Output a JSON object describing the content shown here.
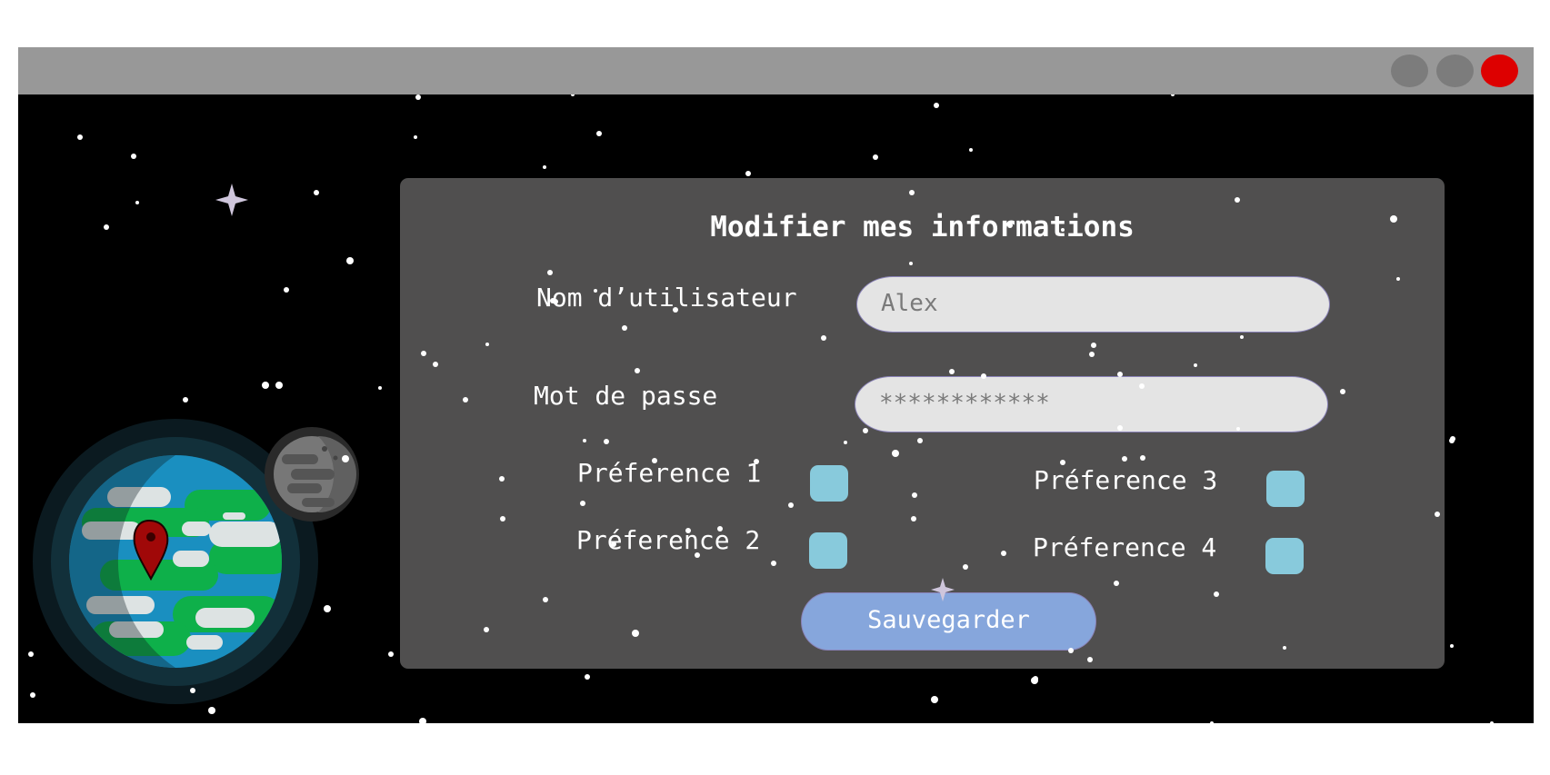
{
  "window": {
    "controls": [
      "minimize-button",
      "maximize-button",
      "close-button"
    ],
    "close_color": "#dd0000",
    "titlebar_color": "#989898",
    "background_color": "#000000"
  },
  "form": {
    "title": "Modifier mes informations",
    "username_label": "Nom d’utilisateur",
    "username_value": "Alex",
    "password_label": "Mot de passe",
    "password_value": "************",
    "preferences": [
      {
        "label": "Préference 1",
        "checked": false
      },
      {
        "label": "Préference 2",
        "checked": false
      },
      {
        "label": "Préference 3",
        "checked": false
      },
      {
        "label": "Préference 4",
        "checked": false
      }
    ],
    "save_label": "Sauvegarder",
    "panel_color": "#504f4f",
    "field_color": "#e4e4e4",
    "checkbox_color": "#88cadc",
    "button_color": "#86a6dc"
  },
  "decor": {
    "planet_icon": "earth-icon",
    "moon_icon": "moon-icon",
    "pin_icon": "map-pin-icon",
    "sparkle_icon": "sparkle-star-icon"
  }
}
